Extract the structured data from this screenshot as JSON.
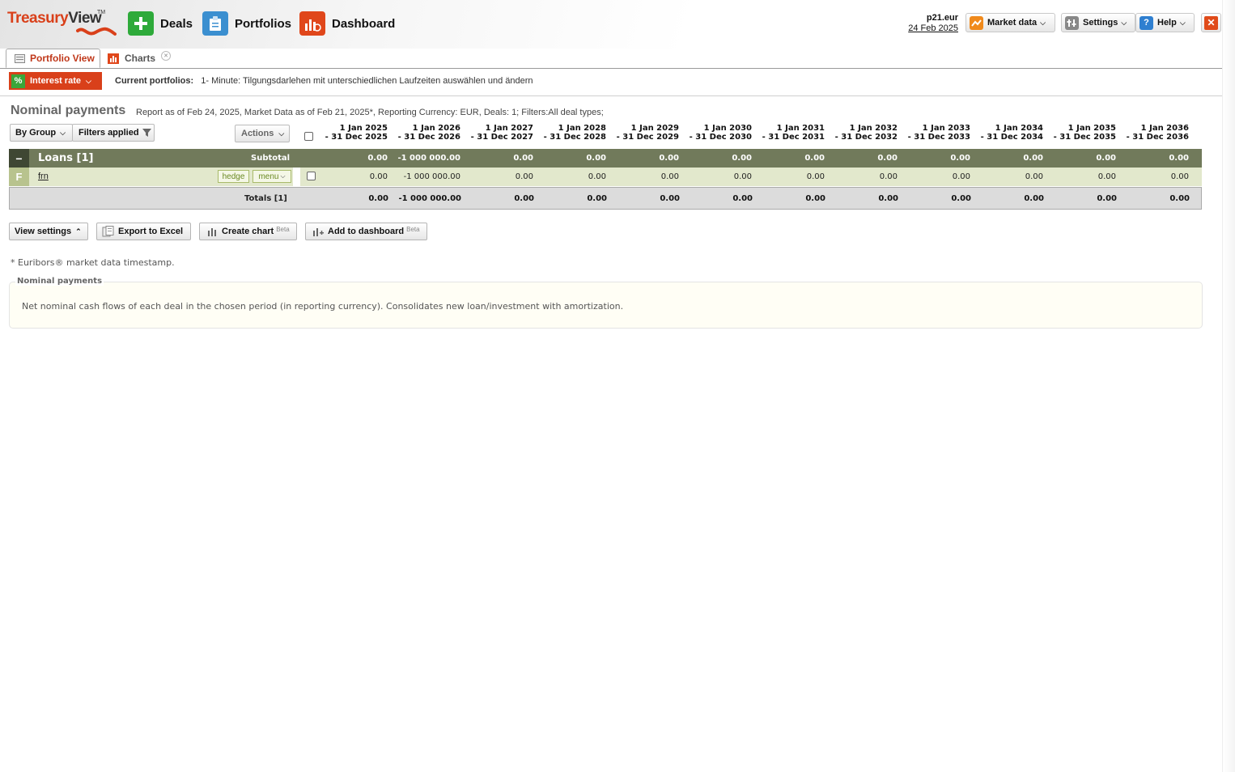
{
  "brand": {
    "logo_part1": "Treasury",
    "logo_part2": "View",
    "tm": "TM"
  },
  "nav": {
    "deals": "Deals",
    "portfolios": "Portfolios",
    "dashboard": "Dashboard"
  },
  "account": {
    "name": "p21.eur",
    "date": "24 Feb 2025"
  },
  "toolbar": {
    "market_data": "Market data",
    "settings": "Settings",
    "help": "Help"
  },
  "tabs": {
    "portfolio_view": "Portfolio View",
    "charts": "Charts"
  },
  "filter_bar": {
    "interest_rate": "Interest rate",
    "current_label": "Current portfolios:",
    "current_value": "1- Minute: Tilgungsdarlehen mit unterschiedlichen Laufzeiten auswählen und ändern"
  },
  "report": {
    "title": "Nominal payments",
    "subtitle": "Report as of Feb 24, 2025, Market Data as of Feb 21, 2025*, Reporting Currency: EUR, Deals: 1; Filters:All deal types;"
  },
  "controls": {
    "by_group": "By Group",
    "filters_applied": "Filters applied",
    "actions": "Actions"
  },
  "columns": [
    {
      "l1": "1 Jan 2025",
      "l2": "- 31 Dec 2025"
    },
    {
      "l1": "1 Jan 2026",
      "l2": "- 31 Dec 2026"
    },
    {
      "l1": "1 Jan 2027",
      "l2": "- 31 Dec 2027"
    },
    {
      "l1": "1 Jan 2028",
      "l2": "- 31 Dec 2028"
    },
    {
      "l1": "1 Jan 2029",
      "l2": "- 31 Dec 2029"
    },
    {
      "l1": "1 Jan 2030",
      "l2": "- 31 Dec 2030"
    },
    {
      "l1": "1 Jan 2031",
      "l2": "- 31 Dec 2031"
    },
    {
      "l1": "1 Jan 2032",
      "l2": "- 31 Dec 2032"
    },
    {
      "l1": "1 Jan 2033",
      "l2": "- 31 Dec 2033"
    },
    {
      "l1": "1 Jan 2034",
      "l2": "- 31 Dec 2034"
    },
    {
      "l1": "1 Jan 2035",
      "l2": "- 31 Dec 2035"
    },
    {
      "l1": "1 Jan 2036",
      "l2": "- 31 Dec 2036"
    }
  ],
  "group": {
    "collapse": "−",
    "name": "Loans [1]",
    "subtotal_label": "Subtotal",
    "values": [
      "0.00",
      "-1 000 000.00",
      "0.00",
      "0.00",
      "0.00",
      "0.00",
      "0.00",
      "0.00",
      "0.00",
      "0.00",
      "0.00",
      "0.00"
    ]
  },
  "deal": {
    "type": "F",
    "name": "frn",
    "hedge": "hedge",
    "menu": "menu",
    "values": [
      "0.00",
      "-1 000 000.00",
      "0.00",
      "0.00",
      "0.00",
      "0.00",
      "0.00",
      "0.00",
      "0.00",
      "0.00",
      "0.00",
      "0.00"
    ]
  },
  "totals": {
    "label": "Totals [1]",
    "values": [
      "0.00",
      "-1 000 000.00",
      "0.00",
      "0.00",
      "0.00",
      "0.00",
      "0.00",
      "0.00",
      "0.00",
      "0.00",
      "0.00",
      "0.00"
    ]
  },
  "actions": {
    "view_settings": "View settings",
    "export_excel": "Export to Excel",
    "create_chart": "Create chart",
    "add_dashboard": "Add to dashboard",
    "beta": "Beta"
  },
  "footnote": "* Euribors® market data timestamp.",
  "info": {
    "legend": "Nominal payments",
    "text": "Net nominal cash flows of each deal in the chosen period (in reporting currency). Consolidates new loan/investment with amortization."
  },
  "colors": {
    "accent": "#d9401a",
    "group_row": "#717a5b",
    "deal_row": "#e2e8cc",
    "deals_icon": "#2eaa3a",
    "portfolios_icon": "#3b8fd0",
    "dashboard_icon": "#e0471b"
  }
}
